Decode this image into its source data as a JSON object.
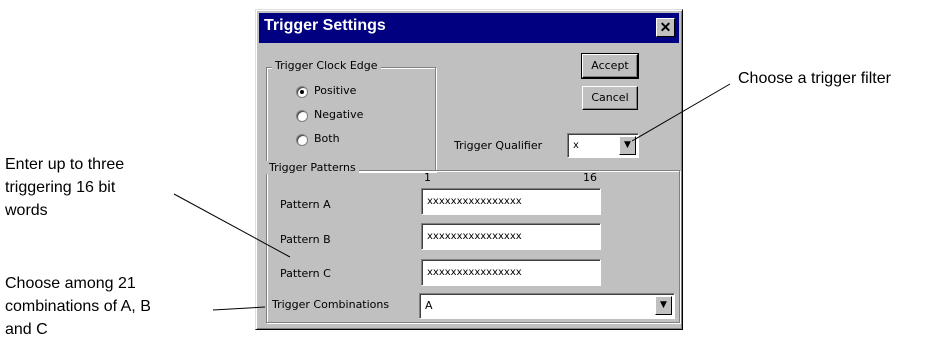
{
  "annotations": {
    "filter": "Choose a trigger filter",
    "words_line1": "Enter up to three",
    "words_line2": "triggering 16 bit",
    "words_line3": "words",
    "combo_line1": "Choose among 21",
    "combo_line2": "combinations of A, B",
    "combo_line3": "and C"
  },
  "dialog": {
    "title": "Trigger Settings",
    "close_glyph": "✕",
    "clock_edge": {
      "legend": "Trigger Clock Edge",
      "options": [
        {
          "label": "Positive",
          "checked": true
        },
        {
          "label": "Negative",
          "checked": false
        },
        {
          "label": "Both",
          "checked": false
        }
      ]
    },
    "buttons": {
      "accept": "Accept",
      "cancel": "Cancel"
    },
    "qualifier": {
      "label": "Trigger Qualifier",
      "value": "x",
      "arrow": "▼"
    },
    "patterns": {
      "legend": "Trigger Patterns",
      "scale_start": "1",
      "scale_end": "16",
      "rows": [
        {
          "label": "Pattern A",
          "value": "xxxxxxxxxxxxxxxx"
        },
        {
          "label": "Pattern B",
          "value": "xxxxxxxxxxxxxxxx"
        },
        {
          "label": "Pattern C",
          "value": "xxxxxxxxxxxxxxxx"
        }
      ],
      "combinations": {
        "label": "Trigger Combinations",
        "value": "A",
        "arrow": "▼"
      }
    }
  }
}
